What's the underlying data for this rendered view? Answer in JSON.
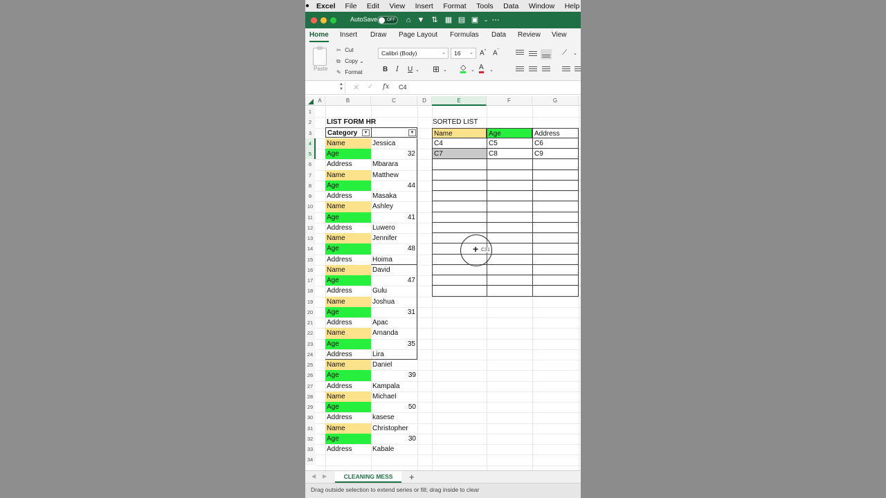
{
  "menubar": {
    "app": "Excel",
    "items": [
      "File",
      "Edit",
      "View",
      "Insert",
      "Format",
      "Tools",
      "Data",
      "Window",
      "Help"
    ]
  },
  "titlebar": {
    "autosave_label": "AutoSave",
    "toggle_state": "OFF"
  },
  "ribbon_tabs": [
    "Home",
    "Insert",
    "Draw",
    "Page Layout",
    "Formulas",
    "Data",
    "Review",
    "View"
  ],
  "ribbon": {
    "paste_label": "Paste",
    "cut_label": "Cut",
    "copy_label": "Copy",
    "format_label": "Format",
    "font_name": "Calibri (Body)",
    "font_size": "16",
    "bold": "B",
    "italic": "I",
    "underline": "U"
  },
  "formula_bar": {
    "fx": "fx",
    "content": "C4"
  },
  "columns": [
    "A",
    "B",
    "C",
    "D",
    "E",
    "F",
    "G"
  ],
  "rows": [
    "1",
    "2",
    "3",
    "4",
    "5",
    "6",
    "7",
    "8",
    "9",
    "10",
    "11",
    "12",
    "13",
    "14",
    "15",
    "16",
    "17",
    "18",
    "19",
    "20",
    "21",
    "22",
    "23",
    "24",
    "25",
    "26",
    "27",
    "28",
    "29",
    "30",
    "31",
    "32",
    "33",
    "34"
  ],
  "list_form": {
    "title": "LIST FORM HR",
    "header": "Category",
    "entries": [
      [
        "Name",
        "Jessica"
      ],
      [
        "Age",
        "32"
      ],
      [
        "Address",
        "Mbarara"
      ],
      [
        "Name",
        "Matthew"
      ],
      [
        "Age",
        "44"
      ],
      [
        "Address",
        "Masaka"
      ],
      [
        "Name",
        "Ashley"
      ],
      [
        "Age",
        "41"
      ],
      [
        "Address",
        "Luwero"
      ],
      [
        "Name",
        "Jennifer"
      ],
      [
        "Age",
        "48"
      ],
      [
        "Address",
        "Hoima"
      ],
      [
        "Name",
        "David"
      ],
      [
        "Age",
        "47"
      ],
      [
        "Address",
        "Gulu"
      ],
      [
        "Name",
        "Joshua"
      ],
      [
        "Age",
        "31"
      ],
      [
        "Address",
        "Apac"
      ],
      [
        "Name",
        "Amanda"
      ],
      [
        "Age",
        "35"
      ],
      [
        "Address",
        "Lira"
      ],
      [
        "Name",
        "Daniel"
      ],
      [
        "Age",
        "39"
      ],
      [
        "Address",
        "Kampala"
      ],
      [
        "Name",
        "Michael"
      ],
      [
        "Age",
        "50"
      ],
      [
        "Address",
        "kasese"
      ],
      [
        "Name",
        "Christopher"
      ],
      [
        "Age",
        "30"
      ],
      [
        "Address",
        "Kabale"
      ]
    ]
  },
  "sorted_list": {
    "title": "SORTED LIST",
    "headers": [
      "Name",
      "Age",
      "Address"
    ],
    "rows": [
      [
        "C4",
        "C5",
        "C6"
      ],
      [
        "C7",
        "C8",
        "C9"
      ]
    ]
  },
  "cursor_tooltip": "C31",
  "sheet_tab": "CLEANING MESS",
  "status_text": "Drag outside selection to extend series or fill; drag inside to clear",
  "colors": {
    "excel_green": "#1f7145",
    "name_fill": "#fde28c",
    "age_fill": "#26f03d"
  }
}
